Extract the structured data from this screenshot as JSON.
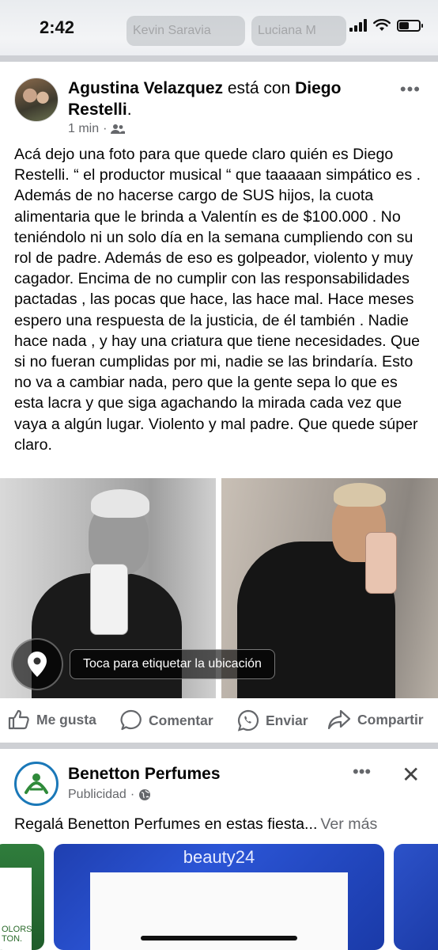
{
  "status_bar": {
    "time": "2:42",
    "story_left": "Kevin Saravia",
    "story_right": "Luciana M"
  },
  "post": {
    "author": "Agustina Velazquez",
    "with_text": " está con ",
    "tagged": "Diego Restelli",
    "tagged_end": ".",
    "time": "1 min",
    "audience_icon": "friends-icon",
    "text": "Acá dejo una foto para que quede claro quién es Diego Restelli. “ el productor musical “ que taaaaan simpático es . Además de no hacerse cargo de SUS hijos, la cuota alimentaria que le brinda a Valentín es de $100.000 . No teniéndolo ni un solo día en la semana cumpliendo con  su rol de padre. Además de eso es golpeador, violento y muy cagador. Encima de no cumplir con las responsabilidades pactadas , las pocas que hace, las hace mal.  Hace meses espero una respuesta de la justicia, de él también . Nadie hace nada , y hay una criatura que tiene necesidades. Que si no fueran cumplidas por mi, nadie se las brindaría. Esto no va a cambiar nada, pero que la gente sepa lo que es esta lacra y que siga agachando la mirada cada vez que vaya a algún lugar. Violento y mal padre. Que quede súper claro.",
    "location_tip": "Toca para etiquetar la ubicación"
  },
  "actions": {
    "like": "Me gusta",
    "comment": "Comentar",
    "send": "Enviar",
    "share": "Compartir"
  },
  "ad": {
    "name": "Benetton Perfumes",
    "sponsored": "Publicidad",
    "text": "Regalá Benetton Perfumes en estas fiesta...",
    "see_more": "Ver más",
    "card_left_text_1": "OLORS",
    "card_left_text_2": "TON.",
    "card_brand": "beauty24"
  },
  "colors": {
    "meta_gray": "#65676b",
    "divider": "#ced0d4",
    "ad_accent": "#1a78b8",
    "benetton_green": "#2f7d3c"
  }
}
